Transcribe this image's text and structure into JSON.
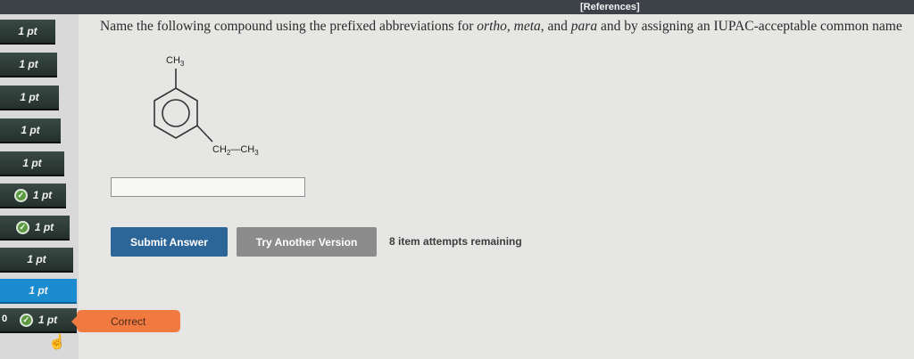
{
  "header": {
    "references_label": "[References]"
  },
  "sidebar": {
    "items": [
      {
        "label": "1 pt",
        "checked": false,
        "active": false
      },
      {
        "label": "1 pt",
        "checked": false,
        "active": false
      },
      {
        "label": "1 pt",
        "checked": false,
        "active": false
      },
      {
        "label": "1 pt",
        "checked": false,
        "active": false
      },
      {
        "label": "1 pt",
        "checked": false,
        "active": false
      },
      {
        "label": "1 pt",
        "checked": true,
        "active": false
      },
      {
        "label": "1 pt",
        "checked": true,
        "active": false
      },
      {
        "label": "1 pt",
        "checked": false,
        "active": false
      },
      {
        "label": "1 pt",
        "checked": false,
        "active": true
      },
      {
        "label": "1 pt",
        "checked": true,
        "active": false
      }
    ],
    "score_prefix": "0",
    "check_icon": "check-circle-icon",
    "colors": {
      "item_bg": "#2d3a36",
      "active_bg": "#1a8ccf",
      "check": "#5c9a42"
    }
  },
  "question": {
    "part1": "Name the following compound using the prefixed abbreviations for ",
    "ortho": "ortho",
    "sep1": ", ",
    "meta": "meta",
    "sep2": ", and ",
    "para": "para",
    "part2": " and by assigning an IUPAC-acceptable common name"
  },
  "structure": {
    "substituent_top": "CH",
    "substituent_top_sub": "3",
    "substituent_side_a": "CH",
    "substituent_side_a_sub": "2",
    "substituent_side_dash": "—CH",
    "substituent_side_b_sub": "3"
  },
  "answer": {
    "value": ""
  },
  "buttons": {
    "submit": "Submit Answer",
    "try_another": "Try Another Version"
  },
  "attempts_text": "8 item attempts remaining",
  "feedback": {
    "correct_label": "Correct",
    "color": "#f07a40"
  }
}
